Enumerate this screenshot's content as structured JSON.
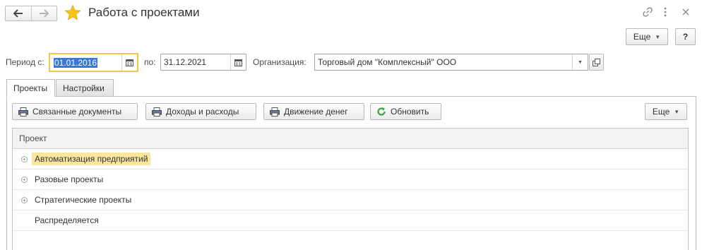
{
  "window": {
    "title": "Работа с проектами",
    "nav_back_icon": "arrow-left-icon",
    "nav_forward_icon": "arrow-right-icon",
    "favorite_icon": "star-icon"
  },
  "header_actions": {
    "more_label": "Еще",
    "help_label": "?"
  },
  "filters": {
    "period_from_label": "Период с:",
    "period_from_value": "01.01.2016",
    "period_to_label": "по:",
    "period_to_value": "31.12.2021",
    "organization_label": "Организация:",
    "organization_value": "Торговый дом \"Комплексный\" ООО"
  },
  "tabs": [
    {
      "label": "Проекты",
      "active": true
    },
    {
      "label": "Настройки",
      "active": false
    }
  ],
  "toolbar": {
    "related_docs": "Связанные документы",
    "income_expense": "Доходы и расходы",
    "cash_flow": "Движение денег",
    "refresh": "Обновить",
    "more": "Еще"
  },
  "grid": {
    "column_header": "Проект",
    "rows": [
      {
        "label": "Автоматизация предприятий",
        "expandable": true,
        "selected": true
      },
      {
        "label": "Разовые проекты",
        "expandable": true,
        "selected": false
      },
      {
        "label": "Стратегические проекты",
        "expandable": true,
        "selected": false
      },
      {
        "label": "Распределяется",
        "expandable": false,
        "selected": false
      }
    ]
  },
  "colors": {
    "focus_border": "#f2c744",
    "selection": "#3a78d8",
    "current_row": "#fbe6a0",
    "refresh_icon": "#3aa544",
    "star": "#f5c518"
  }
}
